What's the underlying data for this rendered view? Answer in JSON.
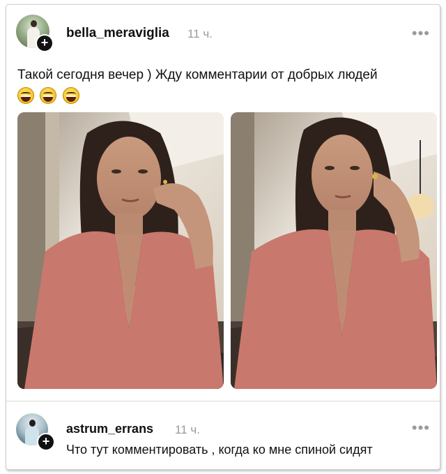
{
  "post": {
    "username": "bella_meraviglia",
    "time": "11 ч.",
    "more_icon": "•••",
    "text": "Такой сегодня вечер ) Жду комментарии от добрых людей",
    "emojis": [
      "grinning-sweat-emoji",
      "grinning-sweat-emoji",
      "grinning-sweat-emoji"
    ],
    "photos": [
      {
        "name": "selfie-photo-1"
      },
      {
        "name": "selfie-photo-2"
      }
    ]
  },
  "comment": {
    "username": "astrum_errans",
    "time": "11 ч.",
    "more_icon": "•••",
    "text": "Что тут комментировать , когда ко мне спиной сидят"
  },
  "colors": {
    "dress": "#c9786d",
    "time_gray": "#9a9a9a",
    "text": "#111111"
  }
}
